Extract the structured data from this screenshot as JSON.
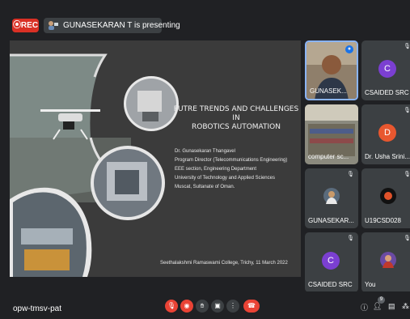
{
  "recording": {
    "label": "⦿REC"
  },
  "presenter_bar": {
    "text": "GUNASEKARAN T is presenting"
  },
  "slide": {
    "title_lines": [
      "FUTRE TRENDS AND CHALLENGES",
      "IN",
      "ROBOTICS AUTOMATION"
    ],
    "info_lines": [
      "Dr. Gunasekaran Thangavel",
      "Program Director (Telecommunications Engineering)",
      "EEE section, Engineering Department",
      "University of  Technology and Applied Sciences",
      "Muscat, Sultanate of Oman."
    ],
    "footer": "Seethalakshmi Ramaswami College, Trichy, 11 March 2022"
  },
  "participants": [
    {
      "label": "GUNASEK...",
      "type": "video-person",
      "active": true
    },
    {
      "label": "CSAIDED SRC",
      "avatar": "C",
      "color": "#7b3fd1"
    },
    {
      "label": "computer sc...",
      "type": "video-room"
    },
    {
      "label": "Dr. Usha Srini...",
      "avatar": "D",
      "color": "#e8572f"
    },
    {
      "label": "GUNASEKAR...",
      "type": "photo-person"
    },
    {
      "label": "U19CSD028",
      "type": "photo-dark"
    },
    {
      "label": "CSAIDED SRC",
      "avatar": "C",
      "color": "#7b3fd1"
    },
    {
      "label": "You",
      "type": "photo-you"
    }
  ],
  "bottom_bar": {
    "meeting_code": "opw-tmsv-pat",
    "participant_count": "9"
  },
  "icons": {
    "record": "record-icon",
    "presenter": "present-screen-icon",
    "mic_off": "mic-off-icon",
    "camera_off": "camera-off-icon",
    "hand": "raise-hand-icon",
    "present": "present-now-icon",
    "more": "more-options-icon",
    "end_call": "end-call-icon",
    "info": "info-icon",
    "people": "people-icon",
    "chat": "chat-icon",
    "activities": "activities-icon"
  },
  "colors": {
    "background": "#202124",
    "tile": "#3c4043",
    "red": "#ea4335",
    "active_border": "#8ab4f8"
  }
}
